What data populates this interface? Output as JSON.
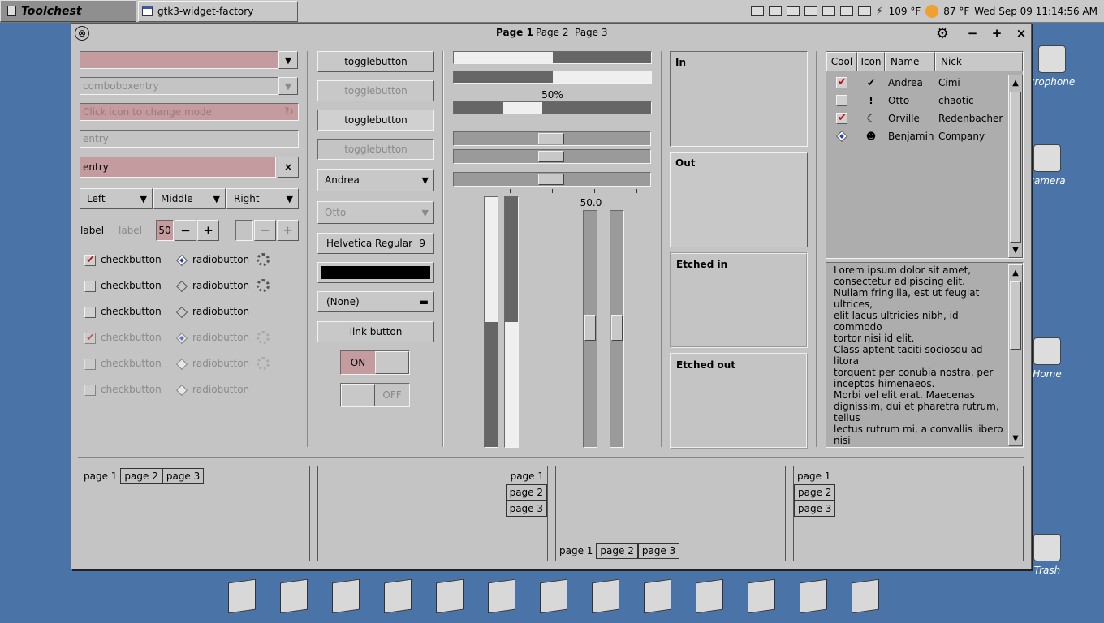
{
  "taskbar": {
    "menu_label": "Toolchest",
    "task_title": "gtk3-widget-factory",
    "temp_cpu": "109 °F",
    "temp_weather": "87 °F",
    "datetime": "Wed Sep 09  11:14:56 AM"
  },
  "desktop_icons": [
    "crophone",
    "camera",
    "Home",
    "Trash"
  ],
  "window": {
    "tabs": [
      "Page 1",
      "Page 2",
      "Page 3"
    ],
    "controls": {
      "close": "×",
      "minimize": "−",
      "maximize": "+",
      "settings": "⚙",
      "close_circle": "⊗"
    }
  },
  "col1": {
    "combo1_value": "",
    "comboboxentry_placeholder": "comboboxentry",
    "icon_entry_placeholder": "Click icon to change mode",
    "entry_placeholder": "entry",
    "entry_value": "entry",
    "entry_clear": "×",
    "dropdowns": [
      "Left",
      "Middle",
      "Right"
    ],
    "label_a": "label",
    "label_b": "label",
    "spin_value": "50",
    "spin_minus": "−",
    "spin_plus": "+",
    "checkbuttons": [
      {
        "label": "checkbutton",
        "checked": true,
        "sensitive": true
      },
      {
        "label": "checkbutton",
        "checked": false,
        "sensitive": true
      },
      {
        "label": "checkbutton",
        "checked": false,
        "sensitive": true
      },
      {
        "label": "checkbutton",
        "checked": true,
        "sensitive": false
      },
      {
        "label": "checkbutton",
        "checked": false,
        "sensitive": false
      },
      {
        "label": "checkbutton",
        "checked": false,
        "sensitive": false
      }
    ],
    "radiobuttons": [
      {
        "label": "radiobutton",
        "active": true,
        "sensitive": true
      },
      {
        "label": "radiobutton",
        "active": false,
        "sensitive": true
      },
      {
        "label": "radiobutton",
        "active": false,
        "sensitive": true
      },
      {
        "label": "radiobutton",
        "active": true,
        "sensitive": false
      },
      {
        "label": "radiobutton",
        "active": false,
        "sensitive": false
      },
      {
        "label": "radiobutton",
        "active": false,
        "sensitive": false
      }
    ]
  },
  "col2": {
    "togglebuttons": [
      "togglebutton",
      "togglebutton",
      "togglebutton",
      "togglebutton"
    ],
    "combo_andrea": "Andrea",
    "combo_otto": "Otto",
    "font_name": "Helvetica Regular",
    "font_size": "9",
    "color_value": "#000000",
    "file_chooser": "(None)",
    "link_button": "link button",
    "switch_on": "ON",
    "switch_off": "OFF"
  },
  "col3": {
    "progress1_fraction": 0.5,
    "progress2_fraction": 0.5,
    "progress3_fraction": 0.5,
    "progress3_label": "50%",
    "scale_value_label": "50.0",
    "vprogress1_fraction": 0.5,
    "vprogress2_fraction": 0.5
  },
  "frames": [
    "In",
    "Out",
    "Etched in",
    "Etched out"
  ],
  "tree": {
    "columns": [
      "Cool",
      "Icon",
      "Name",
      "Nick"
    ],
    "rows": [
      {
        "cool": "checked",
        "icon": "check-circle-icon",
        "name": "Andrea",
        "nick": "Cimi"
      },
      {
        "cool": "unchecked",
        "icon": "alert-circle-icon",
        "name": "Otto",
        "nick": "chaotic"
      },
      {
        "cool": "checked",
        "icon": "moon-icon",
        "name": "Orville",
        "nick": "Redenbacher"
      },
      {
        "cool": "radio",
        "icon": "user-icon",
        "name": "Benjamin",
        "nick": "Company"
      }
    ]
  },
  "textview": "Lorem ipsum dolor sit amet,\nconsectetur adipiscing elit.\nNullam fringilla, est ut feugiat ultrices,\nelit lacus ultricies nibh, id commodo\ntortor nisi id elit.\nClass aptent taciti sociosqu ad litora\ntorquent per conubia nostra, per\ninceptos himenaeos.\nMorbi vel elit erat. Maecenas\ndignissim, dui et pharetra rutrum, tellus\nlectus rutrum mi, a convallis libero nisi\nquis tellus.\nNulla facilisi. Nullam eleifend lobortis\nnisl, in porttitor tellus malesuada vitae.\nAenean lacus tellus, pellentesque quis\nmolestie quis, fringilla in arcu.",
  "notebooks": [
    {
      "tabs": [
        "page 1",
        "page 2",
        "page 3"
      ]
    },
    {
      "tabs": [
        "page 1",
        "page 2",
        "page 3"
      ]
    },
    {
      "tabs": [
        "page 1",
        "page 2",
        "page 3"
      ]
    },
    {
      "tabs": [
        "page 1",
        "page 2",
        "page 3"
      ]
    }
  ],
  "dock": [
    "folder-icon",
    "script-icon",
    "editor-icon",
    "archive-icon",
    "grid-icon",
    "phone-icon",
    "firefox-icon",
    "paint-icon",
    "pdf-icon",
    "tv-icon",
    "pyramid-icon",
    "document-icon",
    "computer-icon"
  ],
  "colors": {
    "desktop": "#4a74a8",
    "window_bg": "#c4c4c4",
    "entry_pink": "#c49b9e",
    "check_red": "#c01010"
  }
}
